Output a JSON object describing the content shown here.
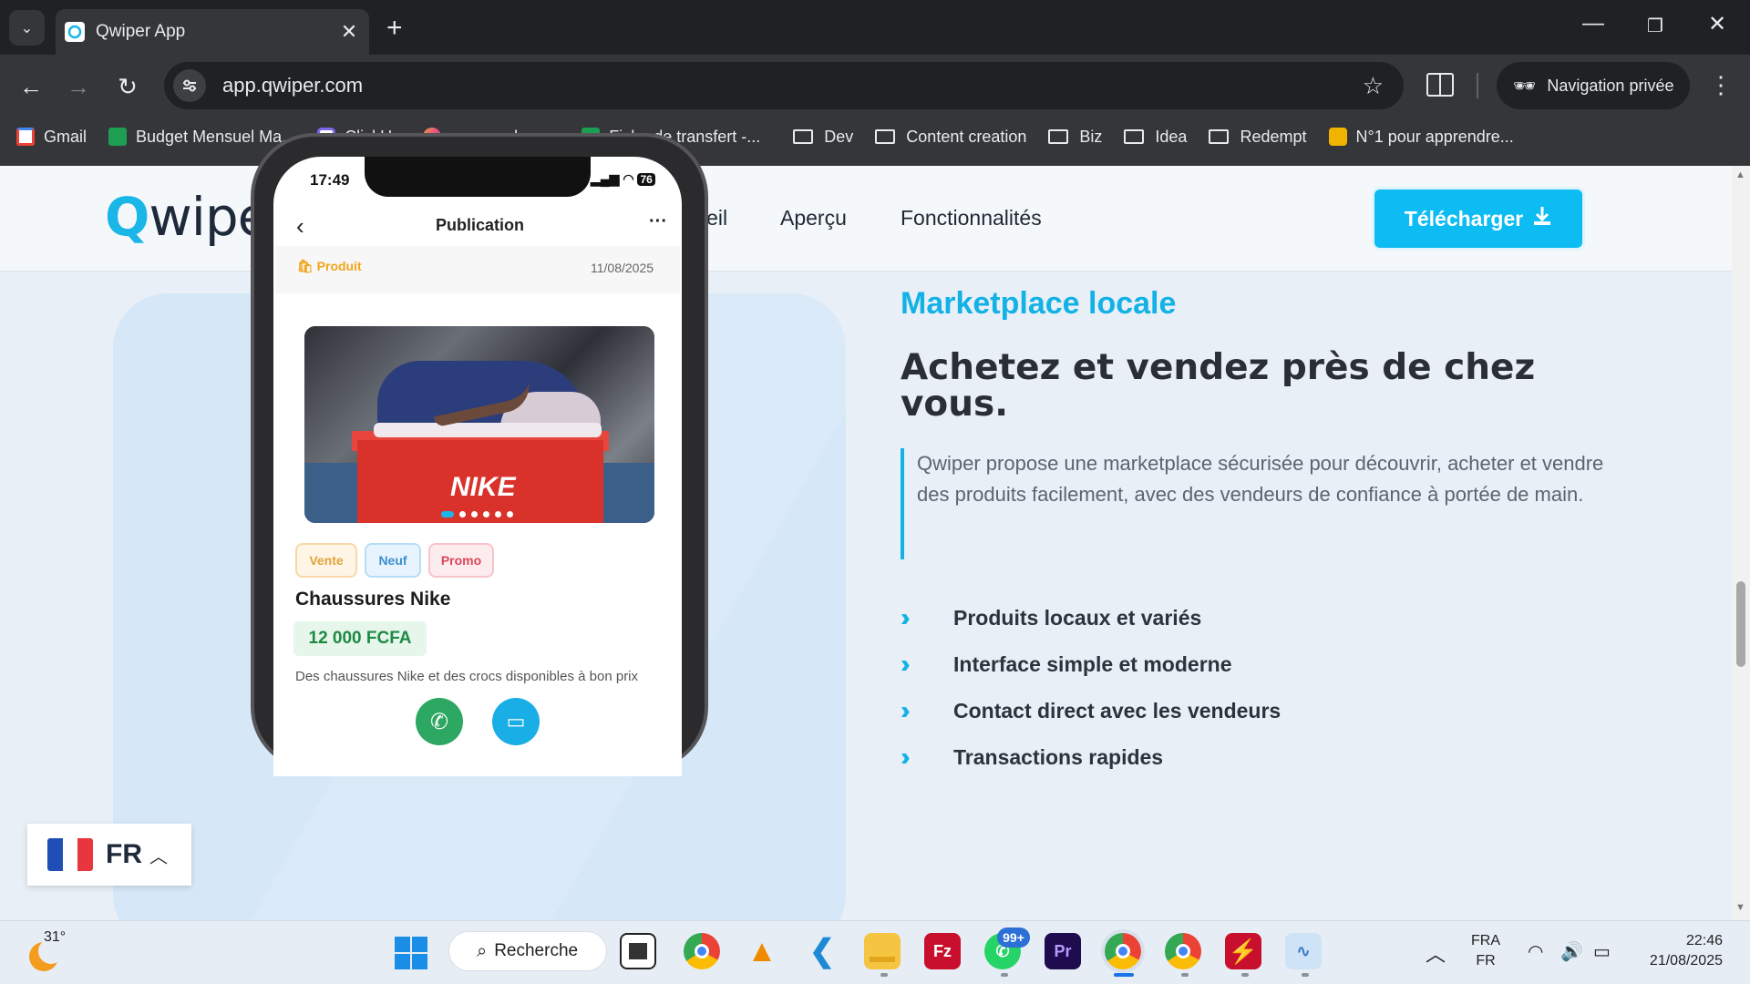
{
  "browser": {
    "tab_title": "Qwiper App",
    "url": "app.qwiper.com",
    "private_label": "Navigation privée",
    "bookmarks": [
      {
        "label": "Gmail",
        "icon": "gmail-icon",
        "color": "#ea4335"
      },
      {
        "label": "Budget Mensuel Ma...",
        "icon": "sheets-icon",
        "color": "#1e9e52"
      },
      {
        "label": "ClickUp",
        "icon": "clickup-icon",
        "color": "#7b68ee"
      },
      {
        "label": "money-planner",
        "icon": "moneyplanner-icon",
        "color": "#e84c8a"
      },
      {
        "label": "Fiche de transfert -...",
        "icon": "sheets-icon",
        "color": "#1e9e52"
      },
      {
        "label": "Dev",
        "icon": "folder-icon"
      },
      {
        "label": "Content creation",
        "icon": "folder-icon"
      },
      {
        "label": "Biz",
        "icon": "folder-icon"
      },
      {
        "label": "Idea",
        "icon": "folder-icon"
      },
      {
        "label": "Redempt",
        "icon": "folder-icon"
      },
      {
        "label": "N°1 pour apprendre...",
        "icon": "site-icon",
        "color": "#f0b400"
      }
    ]
  },
  "site": {
    "logo": {
      "q": "Q",
      "rest": "wiper"
    },
    "nav": [
      "Accueil",
      "Aperçu",
      "Fonctionnalités"
    ],
    "download_label": "Télécharger",
    "eyebrow": "Marketplace locale",
    "headline": "Achetez et vendez près de chez vous.",
    "description": "Qwiper propose une marketplace sécurisée pour découvrir, acheter et vendre des produits facilement, avec des vendeurs de confiance à portée de main.",
    "features": [
      "Produits locaux et variés",
      "Interface simple et moderne",
      "Contact direct avec les vendeurs",
      "Transactions rapides"
    ],
    "language": {
      "code": "FR",
      "flag_colors": [
        "#1f4fb4",
        "#ffffff",
        "#e8363f"
      ]
    }
  },
  "phone": {
    "time": "17:49",
    "battery": "76",
    "screen_title": "Publication",
    "category": "Produit",
    "date": "11/08/2025",
    "image_text": "NIKE",
    "tags": [
      "Vente",
      "Neuf",
      "Promo"
    ],
    "product_name": "Chaussures Nike",
    "price": "12 000 FCFA",
    "description": "Des chaussures Nike et des crocs disponibles à bon prix"
  },
  "taskbar": {
    "temperature": "31°",
    "search_label": "Recherche",
    "whatsapp_badge": "99+",
    "ime_top": "FRA",
    "ime_bottom": "FR",
    "time": "22:46",
    "date": "21/08/2025"
  },
  "colors": {
    "accent": "#12b2e6",
    "download_button": "#0cbcf2",
    "page_bg": "#e9eff6"
  }
}
